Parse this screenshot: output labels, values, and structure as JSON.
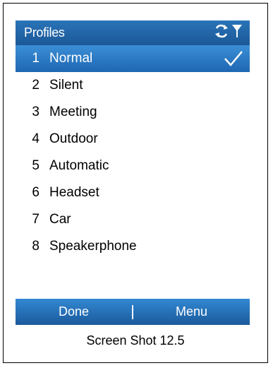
{
  "header": {
    "title": "Profiles",
    "icons": [
      "sync-connection-icon",
      "signal-strength-icon"
    ]
  },
  "profiles": [
    {
      "num": "1",
      "label": "Normal",
      "selected": true,
      "checked": true
    },
    {
      "num": "2",
      "label": "Silent"
    },
    {
      "num": "3",
      "label": "Meeting"
    },
    {
      "num": "4",
      "label": "Outdoor"
    },
    {
      "num": "5",
      "label": "Automatic"
    },
    {
      "num": "6",
      "label": "Headset"
    },
    {
      "num": "7",
      "label": "Car"
    },
    {
      "num": "8",
      "label": "Speakerphone"
    }
  ],
  "softkeys": {
    "left": "Done",
    "right": "Menu"
  },
  "caption": "Screen Shot 12.5",
  "colors": {
    "titlebar": "#1b5898",
    "selection": "#2b7ac4",
    "softbar": "#2677c0"
  }
}
